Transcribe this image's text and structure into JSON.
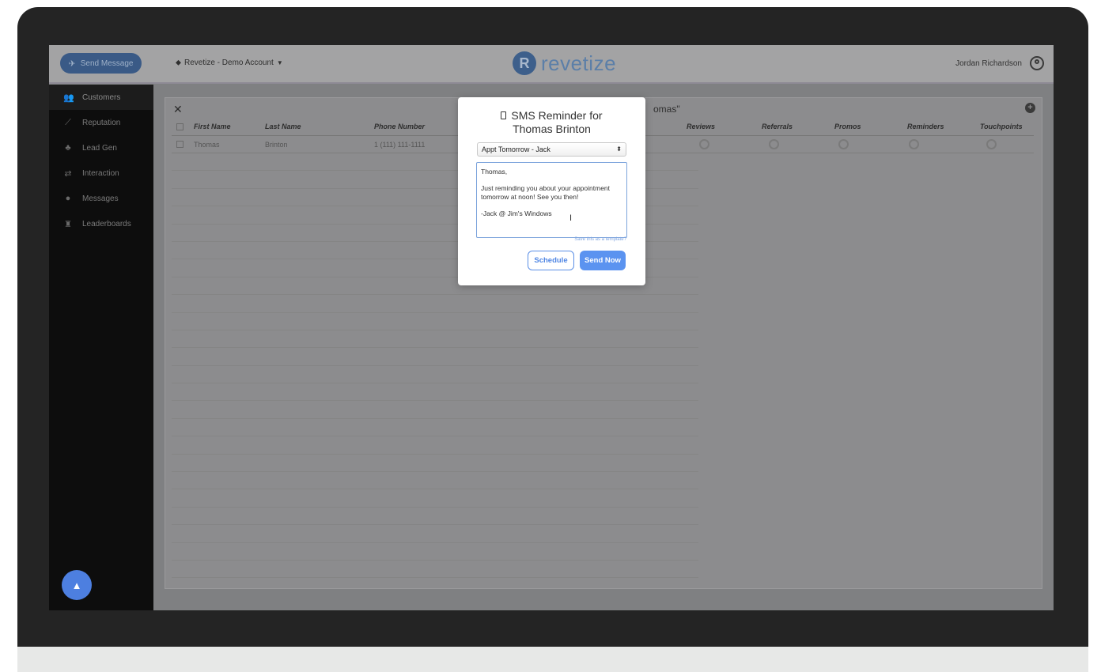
{
  "topbar": {
    "send_message_label": "Send Message",
    "account_label": "Revetize - Demo Account",
    "logo_text": "revetize",
    "logo_mark": "R",
    "user_name": "Jordan Richardson"
  },
  "sidebar": {
    "items": [
      {
        "label": "Customers",
        "icon": "users-icon"
      },
      {
        "label": "Reputation",
        "icon": "chart-icon"
      },
      {
        "label": "Lead Gen",
        "icon": "user-plus-icon"
      },
      {
        "label": "Interaction",
        "icon": "retweet-icon"
      },
      {
        "label": "Messages",
        "icon": "chat-icon"
      },
      {
        "label": "Leaderboards",
        "icon": "trophy-icon"
      }
    ]
  },
  "table": {
    "search_fragment": "omas\"",
    "headers": [
      "First Name",
      "Last Name",
      "Phone Number",
      "Reviews",
      "Referrals",
      "Promos",
      "Reminders",
      "Touchpoints"
    ],
    "rows": [
      {
        "first": "Thomas",
        "last": "Brinton",
        "phone": "1 (111) 111-1111"
      }
    ]
  },
  "modal": {
    "title_line1": "SMS Reminder for",
    "title_line2": "Thomas Brinton",
    "template_selected": "Appt Tomorrow - Jack",
    "message": "Thomas,\n\nJust reminding you about your appointment tomorrow at noon! See you then!\n\n-Jack @ Jim's Windows",
    "save_template_link": "Save this as a template?",
    "schedule_label": "Schedule",
    "send_now_label": "Send Now"
  },
  "colors": {
    "accent": "#5b93f0",
    "sidebar_bg": "#0d0d0d",
    "overlay": "#7f8082"
  }
}
